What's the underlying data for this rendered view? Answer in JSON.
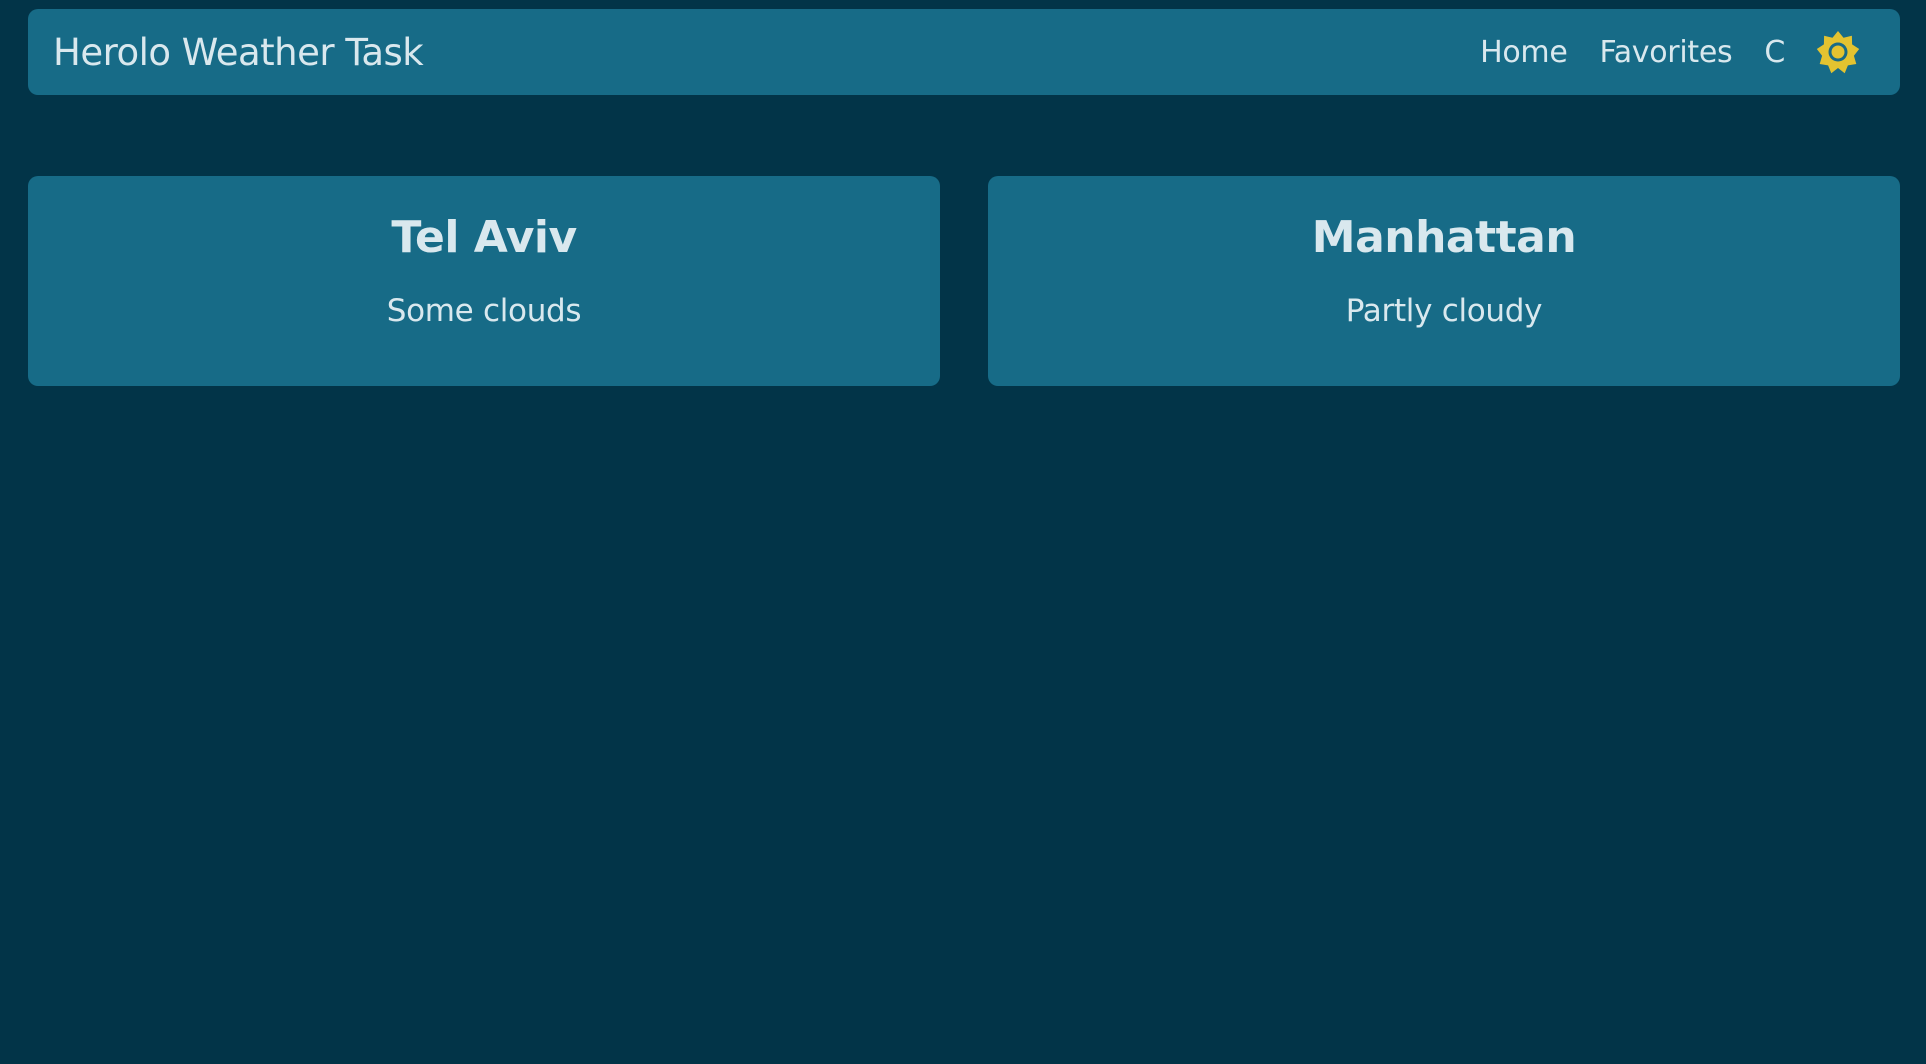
{
  "header": {
    "title": "Herolo Weather Task",
    "nav": {
      "home": "Home",
      "favorites": "Favorites",
      "unit": "C"
    },
    "theme_icon": "sun-icon"
  },
  "favorites": [
    {
      "city": "Tel Aviv",
      "condition": "Some clouds"
    },
    {
      "city": "Manhattan",
      "condition": "Partly cloudy"
    }
  ],
  "colors": {
    "background": "#023448",
    "surface": "#176b87",
    "text": "#d9e8ee",
    "accent": "#e3c330"
  }
}
